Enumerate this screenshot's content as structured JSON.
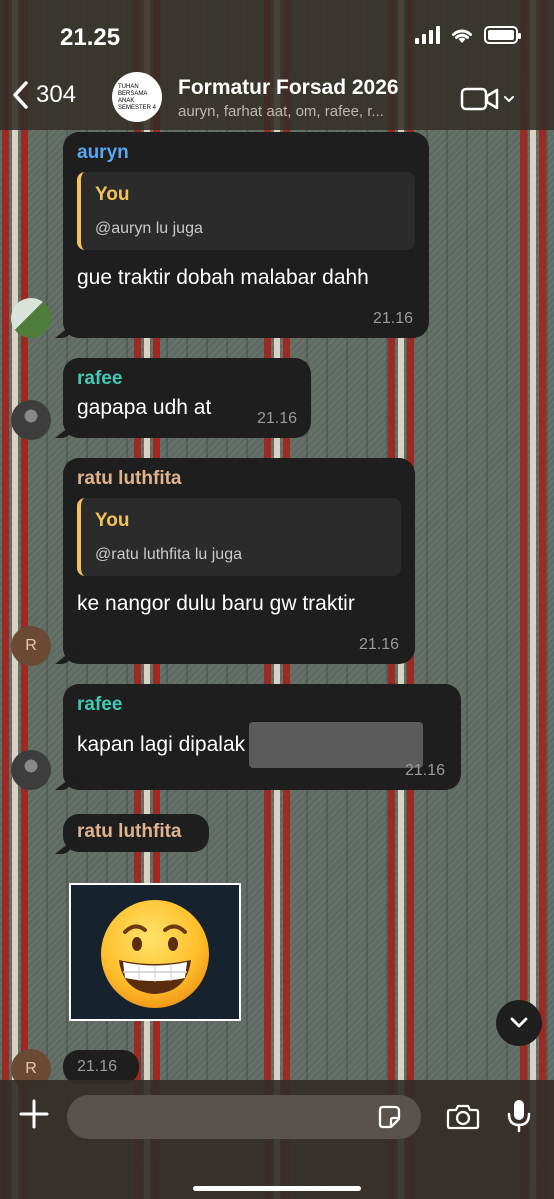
{
  "status": {
    "time": "21.25"
  },
  "header": {
    "back_count": "304",
    "group_avatar_text": "TUHAN BERSAMA ANAK SEMESTER 4",
    "title": "Formatur Forsad 2026",
    "members": "auryn, farhat aat, om, rafee, r..."
  },
  "messages": [
    {
      "sender": "auryn",
      "sender_color": "#5aa6f0",
      "quote_author": "You",
      "quote_text": "@auryn lu juga",
      "text": "gue traktir dobah malabar dahh",
      "time": "21.16"
    },
    {
      "sender": "rafee",
      "sender_color": "#43c9b2",
      "text": "gapapa udh at",
      "time": "21.16"
    },
    {
      "sender": "ratu luthfita",
      "sender_color": "#e0b38f",
      "quote_author": "You",
      "quote_text": "@ratu luthfita lu juga",
      "text": "ke nangor dulu baru gw traktir",
      "time": "21.16",
      "avatar_letter": "R"
    },
    {
      "sender": "rafee",
      "sender_color": "#43c9b2",
      "text": "kapan lagi dipalak",
      "time": "21.16"
    },
    {
      "sender": "ratu luthfita",
      "sender_color": "#e0b38f",
      "sticker": "grinning-sweat-emoji",
      "time": "21.16",
      "avatar_letter": "R"
    }
  ],
  "composer": {
    "placeholder": ""
  },
  "icons": {
    "back": "chevron-left-icon",
    "video": "video-call-icon",
    "plus": "plus-icon",
    "sticker": "sticker-icon",
    "camera": "camera-icon",
    "mic": "microphone-icon",
    "scroll": "chevron-down-icon"
  }
}
